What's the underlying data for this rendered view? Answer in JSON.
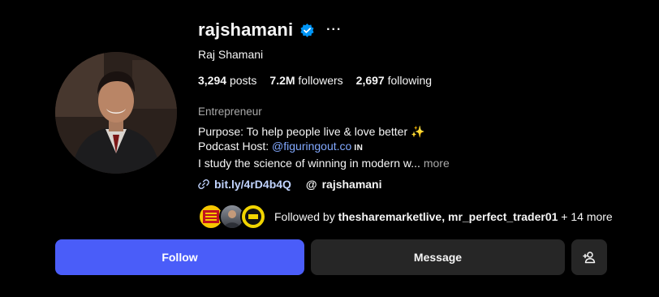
{
  "profile": {
    "username": "rajshamani",
    "full_name": "Raj Shamani",
    "more_options": "···"
  },
  "stats": {
    "posts_count": "3,294",
    "posts_label": "posts",
    "followers_count": "7.2M",
    "followers_label": "followers",
    "following_count": "2,697",
    "following_label": "following"
  },
  "bio": {
    "category": "Entrepreneur",
    "line1": "Purpose: To help people live & love better ✨",
    "line2_prefix": "Podcast Host: ",
    "line2_mention": "@figuringout.co",
    "line2_tag": "IN",
    "line3": "I study the science of winning in modern w...",
    "more_label": "more"
  },
  "links": {
    "url": "bit.ly/4rD4b4Q",
    "threads_handle": "rajshamani",
    "threads_icon": "threads-icon"
  },
  "followed_by": {
    "prefix": "Followed by ",
    "names": "thesharemarketlive, mr_perfect_trader01",
    "suffix": " + 14 more"
  },
  "actions": {
    "follow_label": "Follow",
    "message_label": "Message"
  },
  "colors": {
    "background": "#000000",
    "follow_button": "#4a5df9",
    "secondary_button": "#262626",
    "verified": "#0095f6",
    "mention": "#82a9ff",
    "link": "#c1d4ff",
    "muted": "#a8a8a8"
  }
}
